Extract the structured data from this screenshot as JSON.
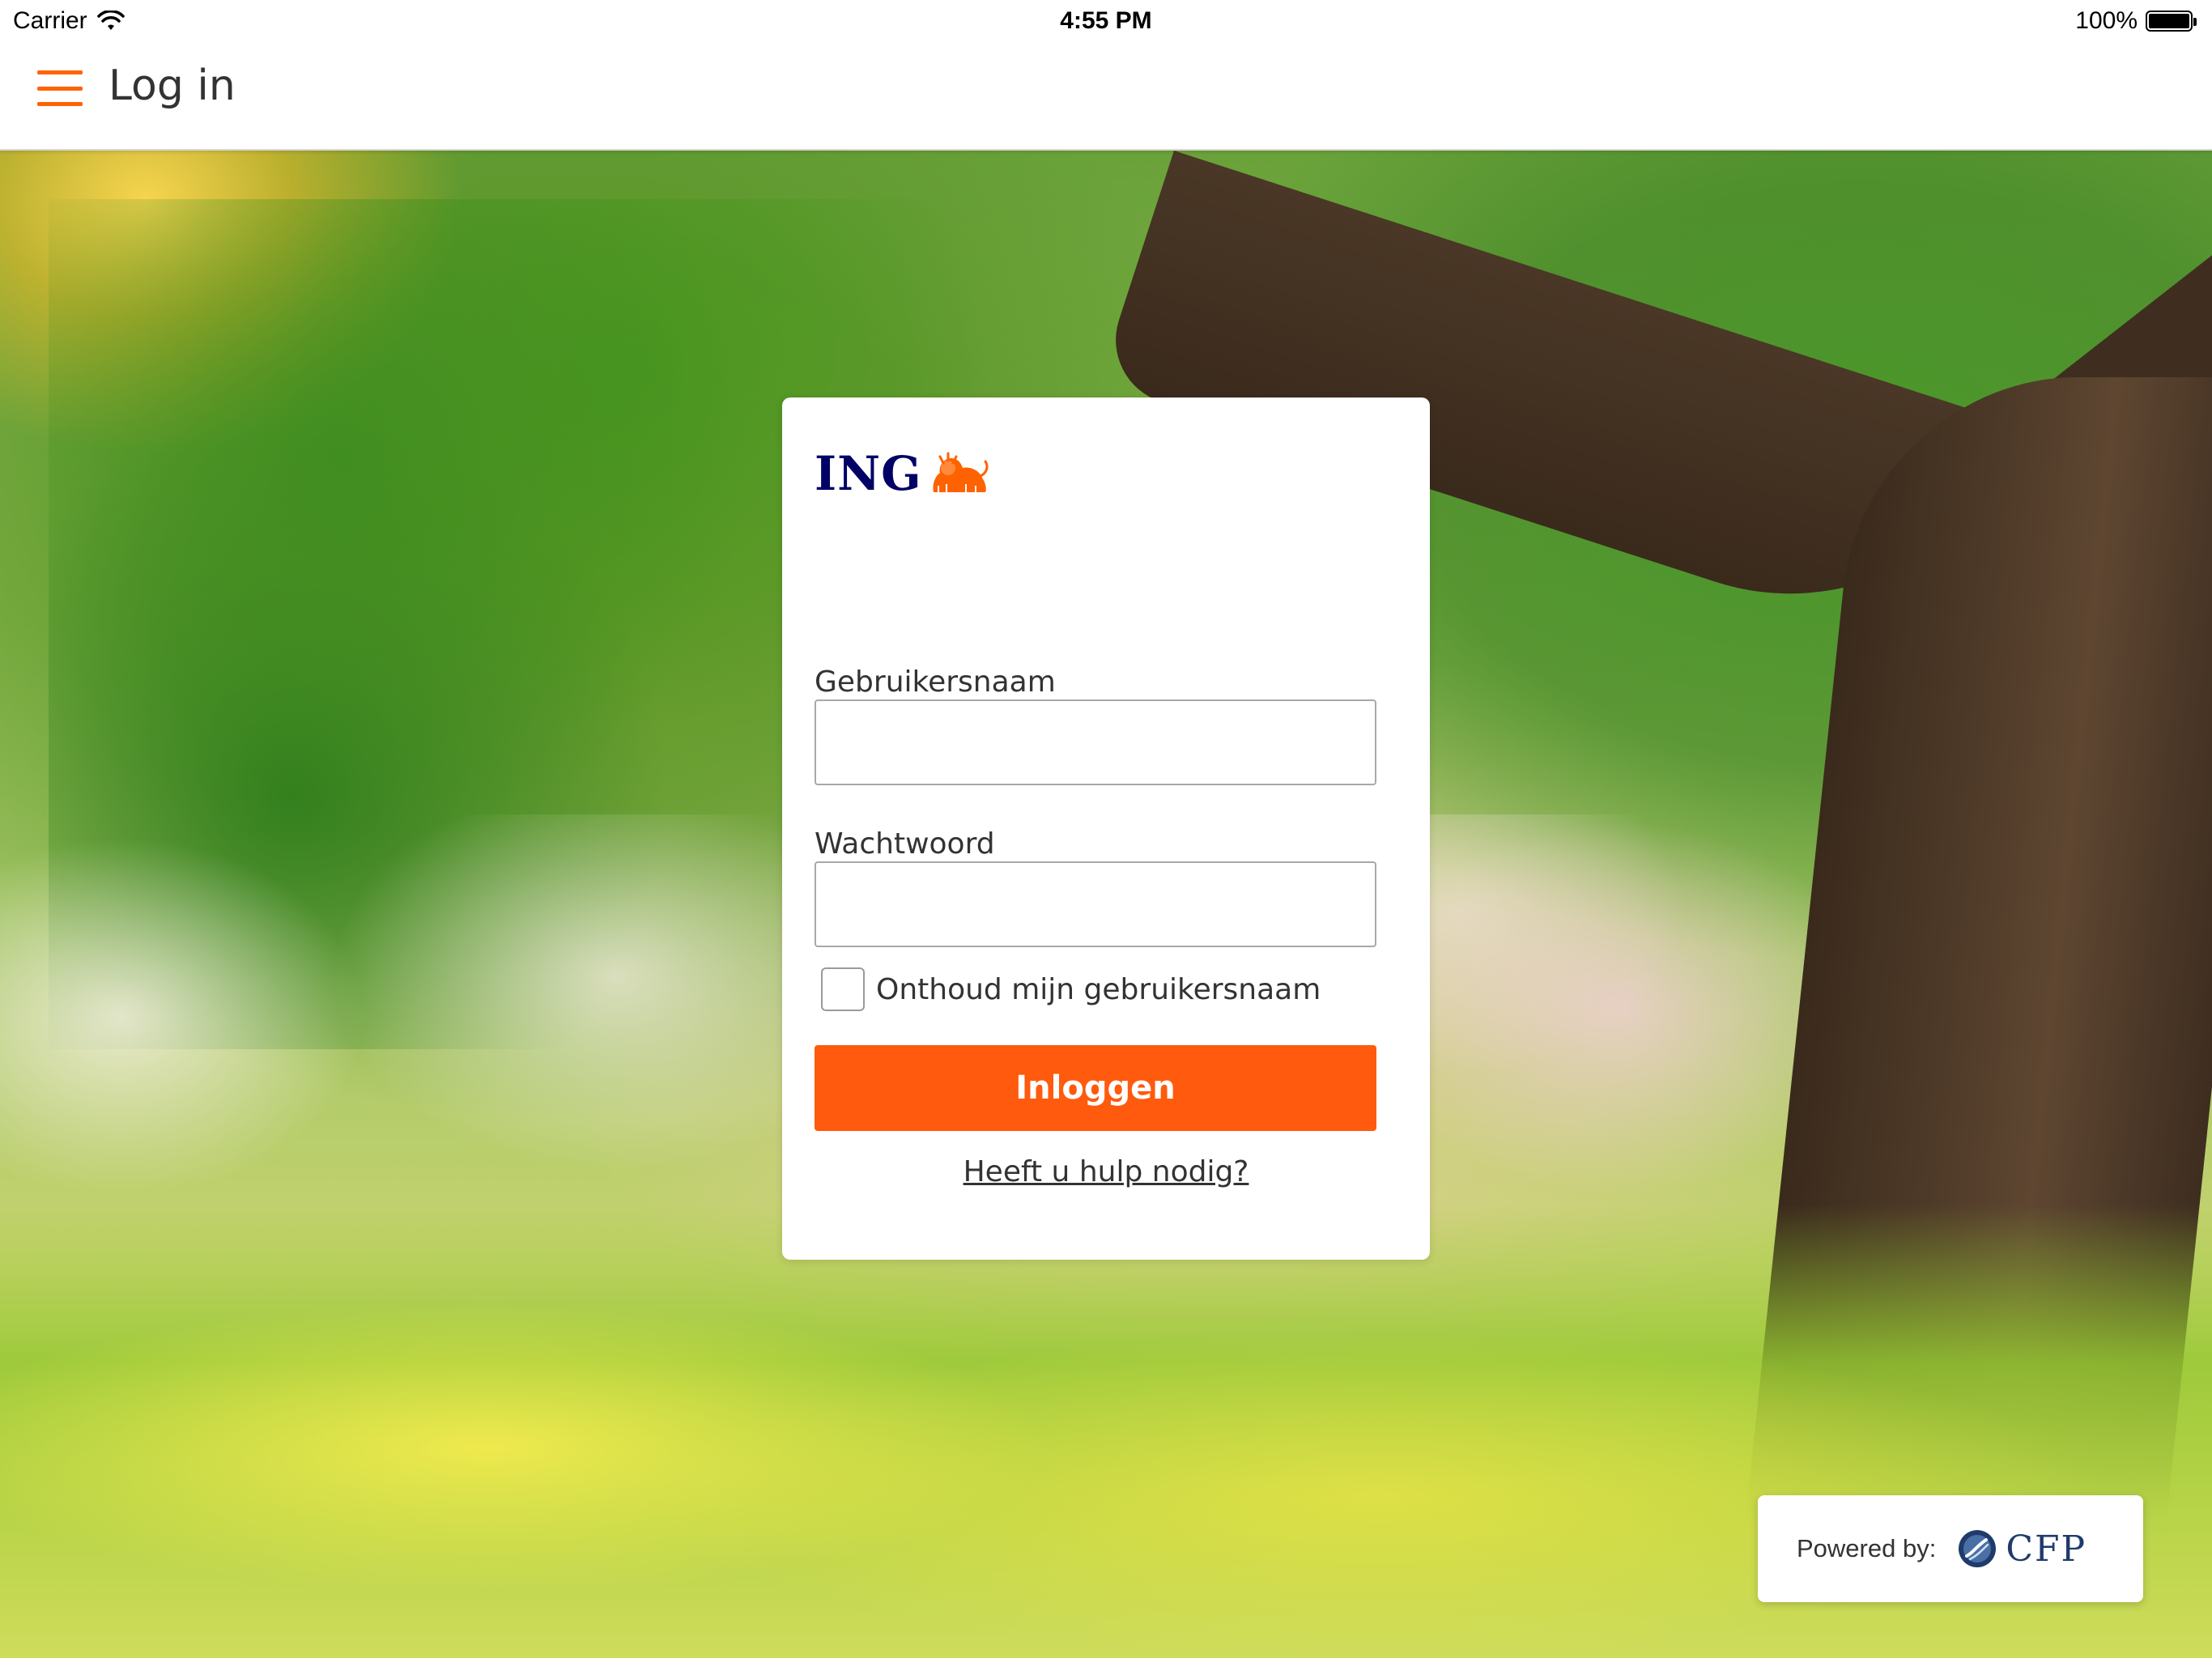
{
  "status_bar": {
    "carrier": "Carrier",
    "time": "4:55 PM",
    "battery": "100%"
  },
  "nav": {
    "title": "Log in"
  },
  "login": {
    "logo_text": "ING",
    "username_label": "Gebruikersnaam",
    "username_value": "",
    "password_label": "Wachtwoord",
    "password_value": "",
    "remember_label": "Onthoud mijn gebruikersnaam",
    "remember_checked": false,
    "submit_label": "Inloggen",
    "help_link": "Heeft u hulp nodig?"
  },
  "powered": {
    "label": "Powered by:",
    "brand": "CFP"
  },
  "colors": {
    "accent": "#ff6200",
    "button": "#ff5a0d",
    "ing_blue": "#000066",
    "cfp_blue": "#1f3b6b"
  },
  "icons": {
    "menu": "hamburger-menu-icon",
    "wifi": "wifi-icon",
    "battery": "battery-icon",
    "ing_lion": "ing-lion-icon",
    "cfp": "cfp-logo-icon"
  }
}
